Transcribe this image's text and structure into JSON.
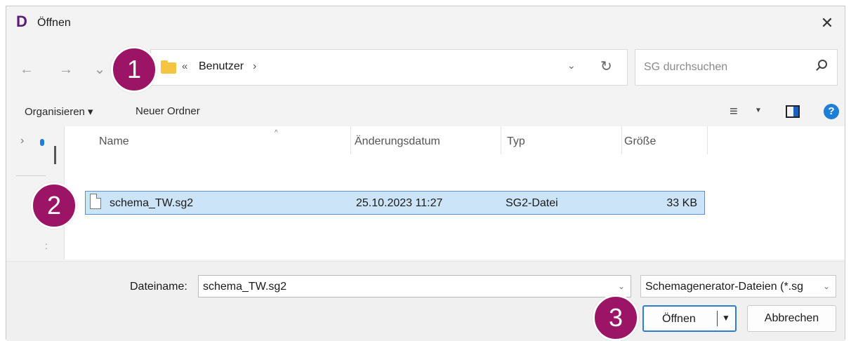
{
  "window": {
    "title": "Öffnen",
    "app_icon": "D",
    "close_glyph": "✕"
  },
  "nav": {
    "back_icon": "←",
    "forward_icon": "→",
    "recent_icon": "⌄",
    "address": {
      "separator": "«",
      "crumb": "Benutzer",
      "chevron": "›",
      "dropdown_icon": "⌄",
      "refresh_icon": "↻"
    },
    "search": {
      "placeholder": "SG durchsuchen"
    }
  },
  "toolbar": {
    "organize_label": "Organisieren ▾",
    "new_folder_label": "Neuer Ordner",
    "view_icon": "≡",
    "view_dropdown": "▼",
    "help_label": "?"
  },
  "navpane": {
    "chevron": "›",
    "dots": ":"
  },
  "columns": {
    "name": "Name",
    "date": "Änderungsdatum",
    "type": "Typ",
    "size": "Größe",
    "sort_arrow": "^"
  },
  "files": [
    {
      "name": "schema_TW.sg2",
      "date": "25.10.2023 11:27",
      "type": "SG2-Datei",
      "size": "33 KB",
      "selected": true
    }
  ],
  "bottom": {
    "filename_label": "Dateiname:",
    "filename_value": "schema_TW.sg2",
    "filename_dropdown": "⌄",
    "filter_value": "Schemagenerator-Dateien (*.sg",
    "filter_dropdown": "⌄",
    "open_label": "Öffnen",
    "open_caret": "▼",
    "cancel_label": "Abbrechen"
  },
  "annotations": {
    "badge1": "1",
    "badge2": "2",
    "badge3": "3",
    "badge_color": "#9b1466"
  },
  "colors": {
    "selection_bg": "#cce4f7",
    "accent": "#2f7fd0"
  }
}
